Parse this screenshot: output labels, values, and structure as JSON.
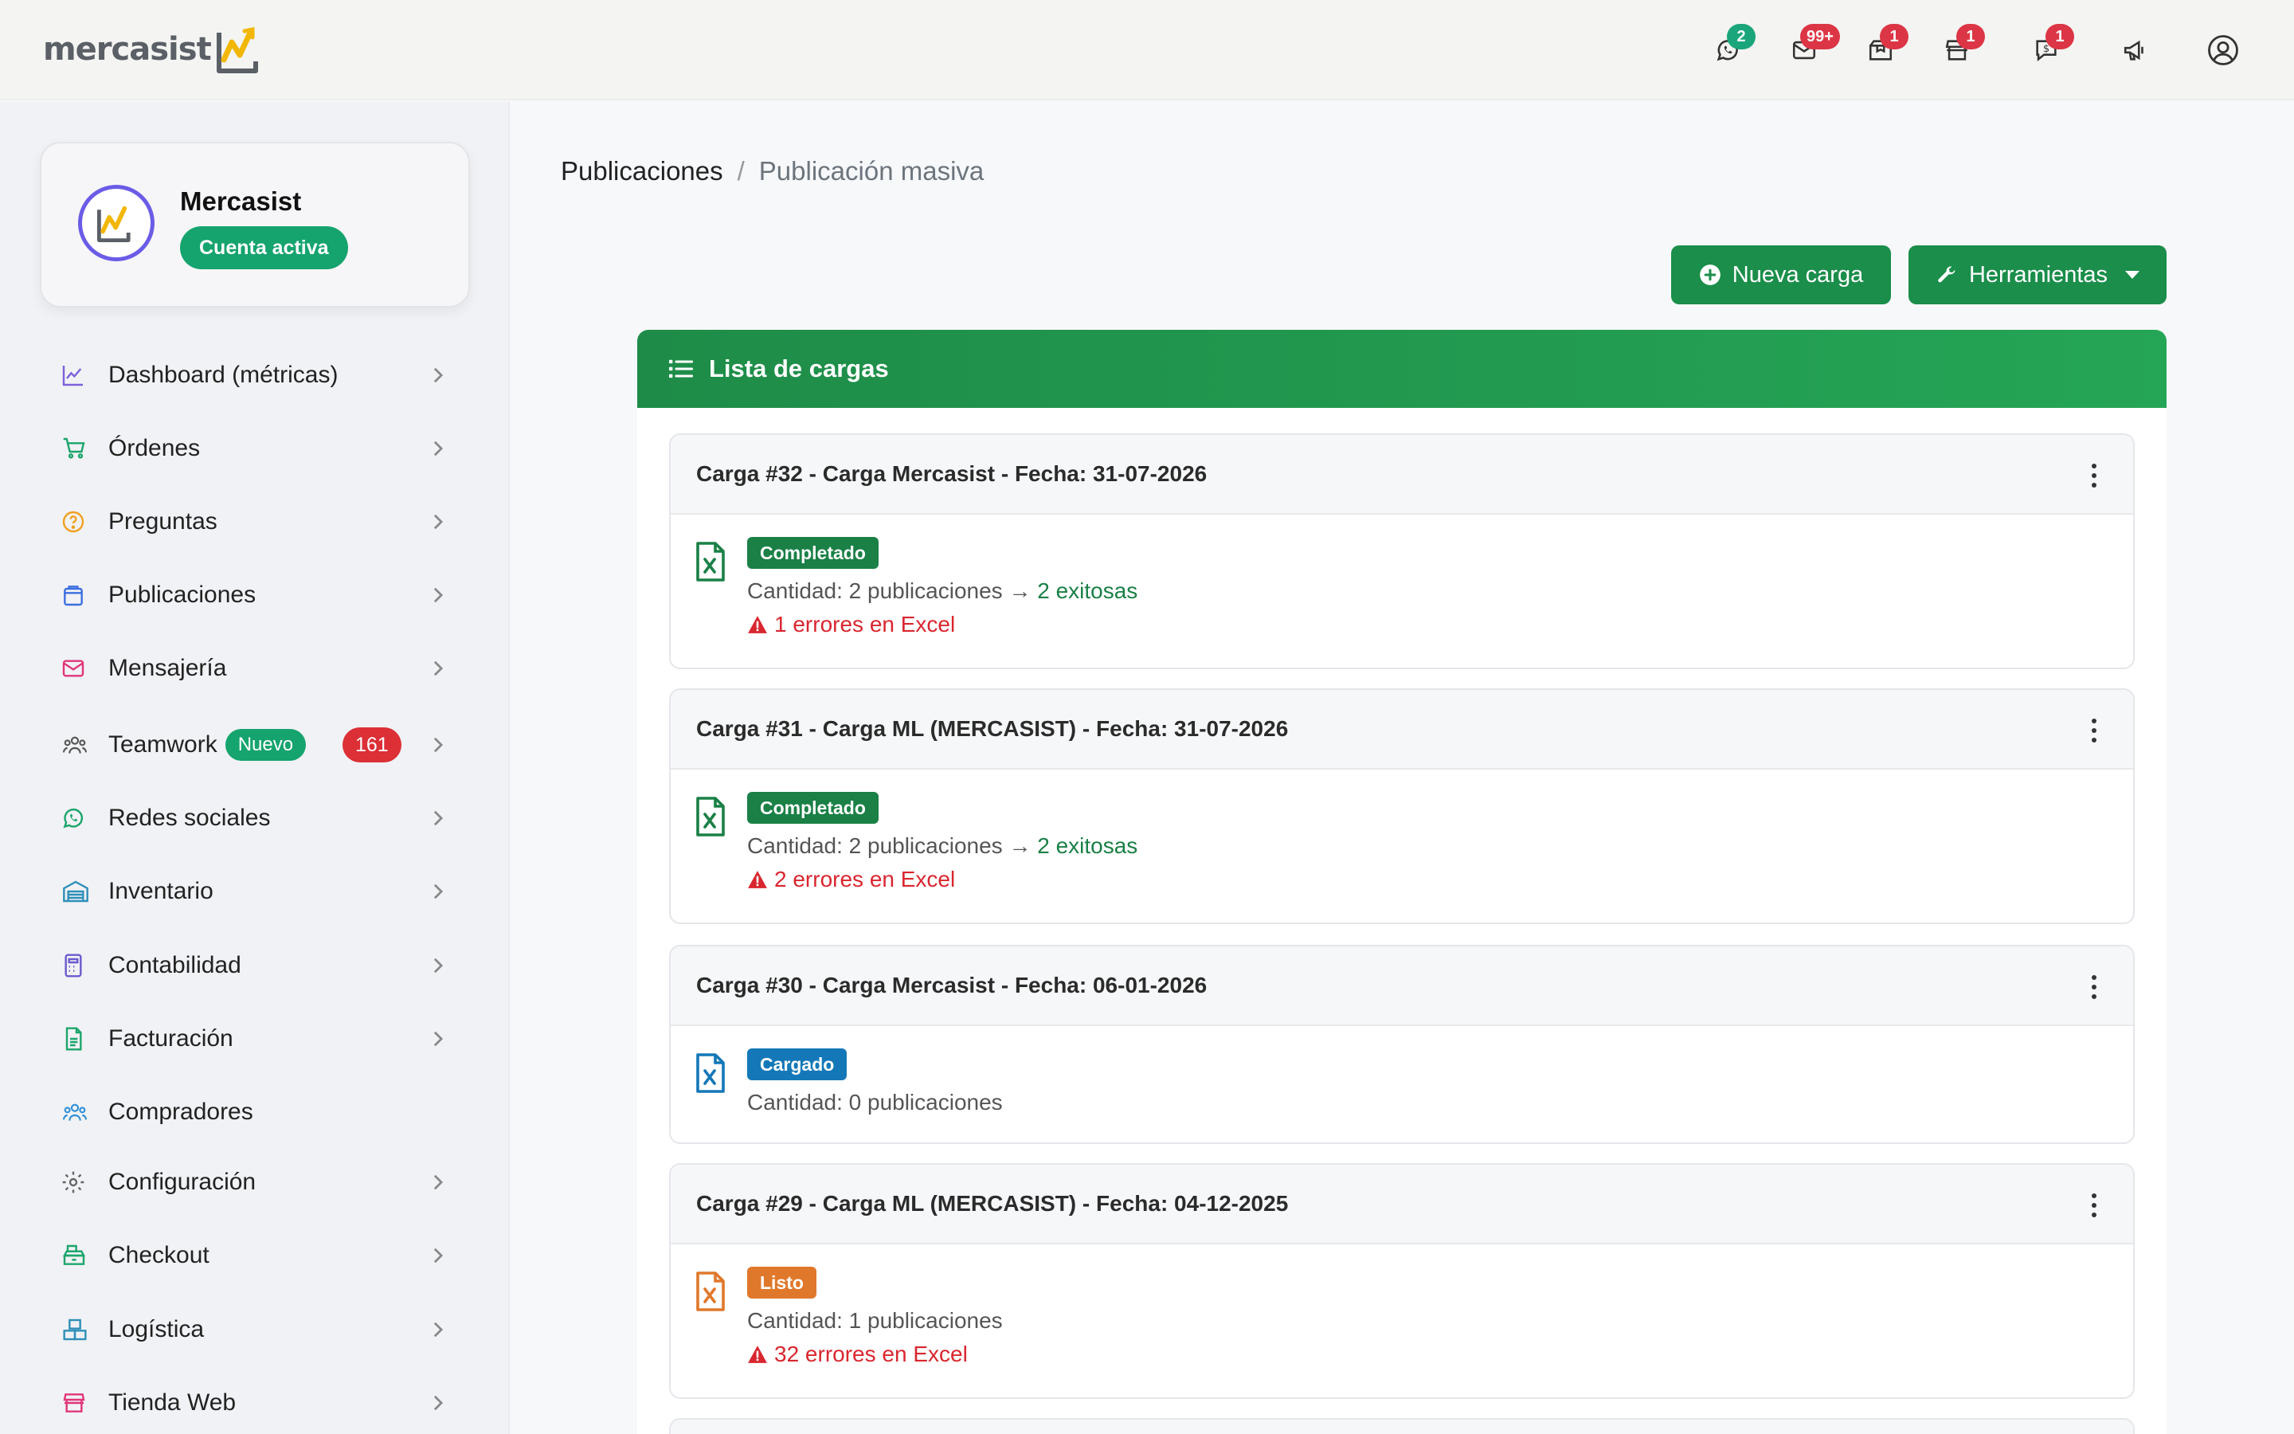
{
  "brand": {
    "name": "mercasist"
  },
  "topbar": {
    "icons": [
      {
        "name": "whatsapp-icon",
        "badge": "2",
        "badge_color": "#1aa57a"
      },
      {
        "name": "mail-icon",
        "badge": "99+",
        "badge_color": "#dc3545"
      },
      {
        "name": "box-icon",
        "badge": "1",
        "badge_color": "#dc3545"
      },
      {
        "name": "store-icon",
        "badge": "1",
        "badge_color": "#dc3545"
      },
      {
        "name": "billing-chat-icon",
        "badge": "1",
        "badge_color": "#dc3545"
      },
      {
        "name": "megaphone-icon",
        "badge": ""
      },
      {
        "name": "user-icon",
        "badge": ""
      }
    ]
  },
  "account": {
    "name": "Mercasist",
    "status": "Cuenta activa"
  },
  "sidebar": {
    "items": [
      {
        "label": "Dashboard (métricas)",
        "icon": "chart-icon"
      },
      {
        "label": "Órdenes",
        "icon": "cart-icon"
      },
      {
        "label": "Preguntas",
        "icon": "question-icon"
      },
      {
        "label": "Publicaciones",
        "icon": "bag-icon"
      },
      {
        "label": "Mensajería",
        "icon": "mail-icon"
      },
      {
        "label": "Teamwork",
        "icon": "team-icon",
        "pill": "Nuevo",
        "count": "161"
      },
      {
        "label": "Redes sociales",
        "icon": "whatsapp-icon"
      },
      {
        "label": "Inventario",
        "icon": "warehouse-icon"
      },
      {
        "label": "Contabilidad",
        "icon": "calculator-icon"
      },
      {
        "label": "Facturación",
        "icon": "invoice-icon"
      },
      {
        "label": "Compradores",
        "icon": "buyers-icon"
      },
      {
        "label": "Configuración",
        "icon": "gear-icon"
      },
      {
        "label": "Checkout",
        "icon": "cash-register-icon"
      },
      {
        "label": "Logística",
        "icon": "boxes-icon"
      },
      {
        "label": "Tienda Web",
        "icon": "store-icon"
      }
    ]
  },
  "breadcrumb": {
    "parent": "Publicaciones",
    "separator": "/",
    "current": "Publicación masiva"
  },
  "actions": {
    "new_upload": "Nueva carga",
    "tools": "Herramientas"
  },
  "list": {
    "title": "Lista de cargas",
    "uploads": [
      {
        "title": "Carga #32 - Carga Mercasist - Fecha: 31-07-2026",
        "status": "Completado",
        "status_color": "#1a8046",
        "quantity": "Cantidad: 2 publicaciones →",
        "success": "2 exitosas",
        "errors": "1 errores en Excel",
        "file_color": "#1a8046"
      },
      {
        "title": "Carga #31 - Carga ML (MERCASIST) - Fecha: 31-07-2026",
        "status": "Completado",
        "status_color": "#1a8046",
        "quantity": "Cantidad: 2 publicaciones →",
        "success": "2 exitosas",
        "errors": "2 errores en Excel",
        "file_color": "#1a8046"
      },
      {
        "title": "Carga #30 - Carga Mercasist - Fecha: 06-01-2026",
        "status": "Cargado",
        "status_color": "#1478b8",
        "quantity": "Cantidad: 0 publicaciones",
        "success": "",
        "errors": "",
        "file_color": "#1478b8"
      },
      {
        "title": "Carga #29 - Carga ML (MERCASIST) - Fecha: 04-12-2025",
        "status": "Listo",
        "status_color": "#e0782b",
        "quantity": "Cantidad: 1 publicaciones",
        "success": "",
        "errors": "32 errores en Excel",
        "file_color": "#e0782b"
      }
    ]
  }
}
